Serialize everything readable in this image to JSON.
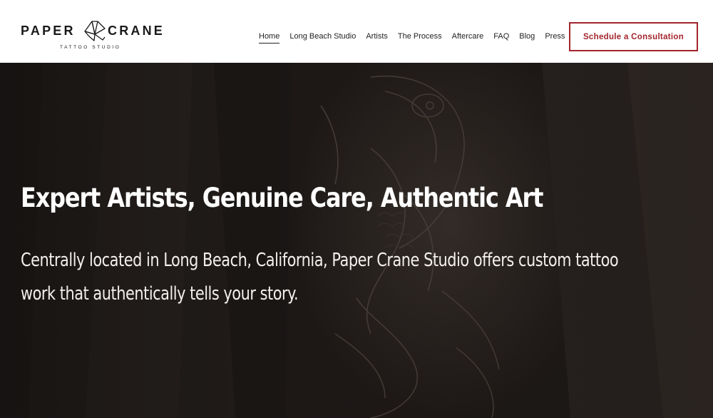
{
  "brand": {
    "word_left": "PAPER",
    "word_right": "CRANE",
    "subtitle": "TATTOO STUDIO",
    "crane_icon": "origami-crane-icon"
  },
  "nav": {
    "items": [
      {
        "label": "Home",
        "active": true
      },
      {
        "label": "Long Beach Studio",
        "active": false
      },
      {
        "label": "Artists",
        "active": false
      },
      {
        "label": "The Process",
        "active": false
      },
      {
        "label": "Aftercare",
        "active": false
      },
      {
        "label": "FAQ",
        "active": false
      },
      {
        "label": "Blog",
        "active": false
      },
      {
        "label": "Press",
        "active": false
      }
    ]
  },
  "cta": {
    "label": "Schedule a Consultation",
    "color": "#a3242c"
  },
  "hero": {
    "title": "Expert Artists, Genuine Care, Authentic Art",
    "text": "Centrally located in Long Beach, California, Paper Crane Studio offers custom tattoo work that authentically tells your story.",
    "background_image": "dark photo of a koi fish tattoo on an arm",
    "overlay_color": "#1d1917"
  }
}
